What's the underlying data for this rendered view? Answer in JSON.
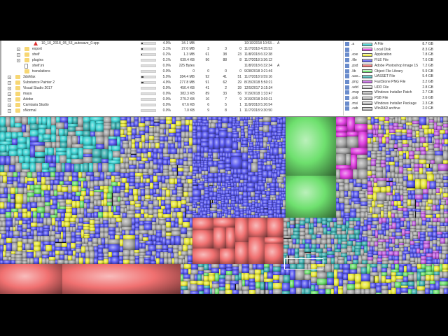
{
  "tree": [
    {
      "name": "10_10_2018_05_53_autosave_0.spp",
      "icon": "warning-file",
      "indent": 3,
      "pct": "4.0%",
      "fill": 0.04,
      "size": "34.1 MB",
      "items": "",
      "files": "",
      "subdirs": "",
      "changed": "10/10/2018 10:53...",
      "attr": "A"
    },
    {
      "name": "export",
      "icon": "folder",
      "indent": 2,
      "expand": true,
      "pct": "3.1%",
      "fill": 0.031,
      "size": "27.0 MB",
      "items": "3",
      "files": "3",
      "subdirs": "0",
      "changed": "11/7/2018 4:35:53",
      "attr": ""
    },
    {
      "name": "shelf",
      "icon": "folder",
      "indent": 2,
      "expand": true,
      "pct": "0.2%",
      "fill": 0.002,
      "size": "1.3 MB",
      "items": "61",
      "files": "38",
      "subdirs": "23",
      "changed": "11/8/2018 6:32:38",
      "attr": ""
    },
    {
      "name": "plugins",
      "icon": "folder",
      "indent": 2,
      "expand": true,
      "pct": "0.1%",
      "fill": 0.001,
      "size": "639.4 KB",
      "items": "96",
      "files": "88",
      "subdirs": "8",
      "changed": "11/7/2018 3:36:12",
      "attr": ""
    },
    {
      "name": "shelf.ini",
      "icon": "file",
      "indent": 2,
      "pct": "0.0%",
      "fill": 0,
      "size": "225 Bytes",
      "items": "",
      "files": "",
      "subdirs": "",
      "changed": "11/8/2018 6:32:34",
      "attr": "A"
    },
    {
      "name": "translations",
      "icon": "folder",
      "indent": 2,
      "pct": "0.0%",
      "fill": 0,
      "size": "0",
      "items": "0",
      "files": "0",
      "subdirs": "0",
      "changed": "9/28/2018 3:21:46",
      "attr": ""
    },
    {
      "name": "3dsMax",
      "icon": "folder",
      "indent": 1,
      "expand": true,
      "pct": "5.0%",
      "fill": 0.05,
      "size": "284.4 MB",
      "items": "92",
      "files": "41",
      "subdirs": "51",
      "changed": "11/7/2018 9:59:16",
      "attr": ""
    },
    {
      "name": "Substance Painter 2",
      "icon": "folder",
      "indent": 1,
      "expand": true,
      "pct": "4.9%",
      "fill": 0.049,
      "size": "277.8 MB",
      "items": "91",
      "files": "62",
      "subdirs": "29",
      "changed": "8/15/2018 5:50:21",
      "attr": ""
    },
    {
      "name": "Visual Studio 2017",
      "icon": "folder",
      "indent": 1,
      "expand": true,
      "pct": "0.0%",
      "fill": 0,
      "size": "450.4 KB",
      "items": "41",
      "files": "2",
      "subdirs": "39",
      "changed": "12/5/2017 3:15:34",
      "attr": ""
    },
    {
      "name": "maya",
      "icon": "folder",
      "indent": 1,
      "expand": true,
      "pct": "0.0%",
      "fill": 0,
      "size": "382.3 KB",
      "items": "89",
      "files": "33",
      "subdirs": "56",
      "changed": "7/19/2018 1:33:47",
      "attr": ""
    },
    {
      "name": "Adobe",
      "icon": "folder",
      "indent": 1,
      "expand": true,
      "pct": "0.0%",
      "fill": 0,
      "size": "279.2 KB",
      "items": "16",
      "files": "7",
      "subdirs": "9",
      "changed": "3/19/2018 3:03:11",
      "attr": ""
    },
    {
      "name": "Camtasia Studio",
      "icon": "folder",
      "indent": 1,
      "expand": true,
      "pct": "0.0%",
      "fill": 0,
      "size": "67.6 KB",
      "items": "6",
      "files": "5",
      "subdirs": "1",
      "changed": "11/9/2018 5:26:54",
      "attr": ""
    },
    {
      "name": "xNormal",
      "icon": "folder",
      "indent": 1,
      "expand": true,
      "pct": "0.0%",
      "fill": 0,
      "size": "7.0 KB",
      "items": "9",
      "files": "8",
      "subdirs": "1",
      "changed": "11/7/2018 9:30:50",
      "attr": ""
    }
  ],
  "extensions": [
    {
      "ext": ".a",
      "desc": "A File",
      "size": "8.7 GB",
      "color": "#3fd3d3"
    },
    {
      "ext": ".",
      "desc": "Local Disk",
      "size": "8.3 GB",
      "color": "#e040e0"
    },
    {
      "ext": ".exe",
      "desc": "Application",
      "size": "7.8 GB",
      "color": "#e8e83a"
    },
    {
      "ext": ".file",
      "desc": "FILE File",
      "size": "7.6 GB",
      "color": "#5a5af0"
    },
    {
      "ext": ".psd",
      "desc": "Adobe Photoshop Image 15",
      "size": "7.2 GB",
      "color": "#f07070"
    },
    {
      "ext": ".lib",
      "desc": "Object File Library",
      "size": "5.9 GB",
      "color": "#6ee06e"
    },
    {
      "ext": ".uas...",
      "desc": "UASSET File",
      "size": "5.4 GB",
      "color": "#3fb0b0"
    },
    {
      "ext": ".png",
      "desc": "FastStone PNG File",
      "size": "3.2 GB",
      "color": "#c060e0"
    },
    {
      "ext": ".udd",
      "desc": "UDD File",
      "size": "2.8 GB",
      "color": "#c8c8c8"
    },
    {
      "ext": ".msp",
      "desc": "Windows Installer Patch",
      "size": "2.7 GB",
      "color": "#b0b0b0"
    },
    {
      "ext": ".psb",
      "desc": "PSB File",
      "size": "2.6 GB",
      "color": "#b0b0b0"
    },
    {
      "ext": ".msi",
      "desc": "Windows Installer Package",
      "size": "2.3 GB",
      "color": "#b0b0b0"
    },
    {
      "ext": ".cab",
      "desc": "WinRAR archive",
      "size": "2.0 GB",
      "color": "#b0b0b0"
    }
  ]
}
